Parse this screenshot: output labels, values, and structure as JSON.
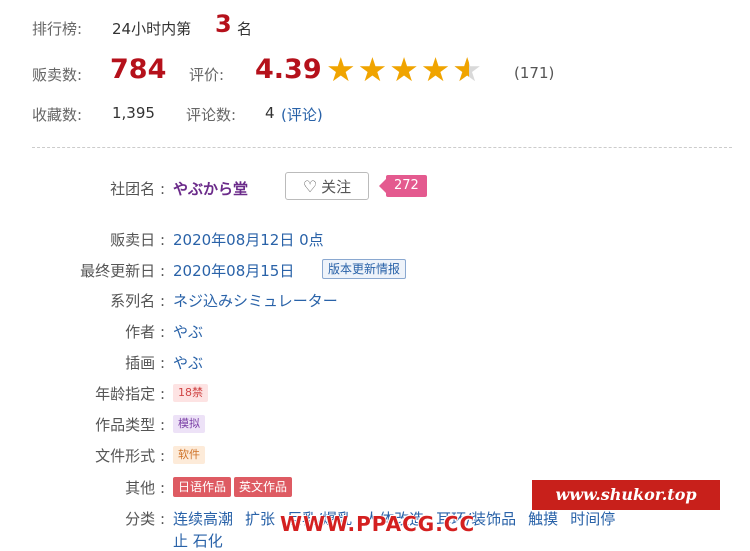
{
  "stats": {
    "rank_label": "排行榜:",
    "rank_prefix": "24小时内第",
    "rank_number": "3",
    "rank_suffix": "名",
    "sales_label": "贩卖数:",
    "sales_value": "784",
    "rating_label": "评价:",
    "rating_value": "4.39",
    "rating_stars": 4.39,
    "rating_count": "(171)",
    "fav_label": "收藏数:",
    "fav_value": "1,395",
    "review_label": "评论数:",
    "review_value": "4",
    "review_link": "(评论)"
  },
  "details": {
    "circle_label": "社团名 :",
    "circle_name": "やぶから堂",
    "follow_label": "关注",
    "follow_count": "272",
    "release_label": "贩卖日 :",
    "release_value": "2020年08月12日 0点",
    "updated_label": "最终更新日 :",
    "updated_value": "2020年08月15日",
    "updated_tag": "版本更新情报",
    "series_label": "系列名 :",
    "series_value": "ネジ込みシミュレーター",
    "author_label": "作者 :",
    "author_value": "やぶ",
    "illustrator_label": "插画 :",
    "illustrator_value": "やぶ",
    "age_label": "年龄指定 :",
    "age_value": "18禁",
    "type_label": "作品类型 :",
    "type_value": "模拟",
    "format_label": "文件形式 :",
    "format_value": "软件",
    "other_label": "其他 :",
    "other_tags": [
      "日语作品",
      "英文作品"
    ],
    "genre_label": "分类 :",
    "genres": [
      "连续高潮",
      "扩张",
      "巨乳/爆乳",
      "人体改造",
      "耳环/装饰品",
      "触摸",
      "时间停"
    ],
    "genre_overflow": "止 石化"
  },
  "watermarks": {
    "site1": "www.shukor.top",
    "site2": "WWW.PPACG.CC"
  },
  "colors": {
    "accent_red": "#b5111b",
    "star": "#f0a400",
    "link": "#2962a8",
    "circle": "#6b2b8a"
  }
}
